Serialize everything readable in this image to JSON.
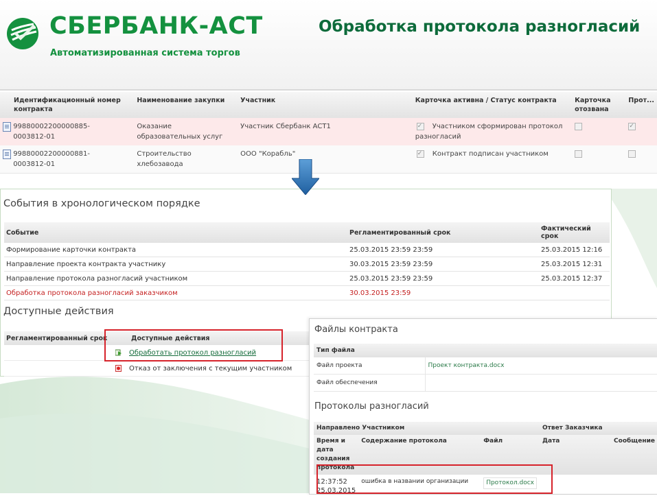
{
  "header": {
    "brand": "СБЕРБАНК-АСТ",
    "brand_subtitle": "Автоматизированная система торгов",
    "slide_title": "Обработка протокола разногласий",
    "brand_color": "#14913f"
  },
  "contracts": {
    "columns": [
      "Идентификационный номер контракта",
      "Наименование закупки",
      "Участник",
      "Карточка активна / Статус контракта",
      "Карточка отозвана",
      "Прот..."
    ],
    "rows": [
      {
        "id": "99880002200000885-0003812-01",
        "name": "Оказание образовательных услуг",
        "participant": "Участник Сбербанк АСТ1",
        "status": "Участником сформирован протокол разногласий",
        "active": true,
        "revoked": false,
        "protocol": true
      },
      {
        "id": "99880002200000881-0003812-01",
        "name": "Строительство хлебозавода",
        "participant": "ООО \"Корабль\"",
        "status": "Контракт подписан участником",
        "active": true,
        "revoked": false,
        "protocol": false
      }
    ]
  },
  "events": {
    "title": "События в хронологическом порядке",
    "columns": [
      "Событие",
      "Регламентированный срок",
      "Фактический срок"
    ],
    "rows": [
      {
        "event": "Формирование карточки контракта",
        "deadline": "25.03.2015 23:59 23:59",
        "actual": "25.03.2015 12:16",
        "alert": false
      },
      {
        "event": "Направление проекта контракта участнику",
        "deadline": "30.03.2015 23:59 23:59",
        "actual": "25.03.2015 12:31",
        "alert": false
      },
      {
        "event": "Направление протокола разногласий участником",
        "deadline": "25.03.2015 23:59 23:59",
        "actual": "25.03.2015 12:37",
        "alert": false
      },
      {
        "event": "Обработка протокола разногласий заказчиком",
        "deadline": "30.03.2015 23:59",
        "actual": "",
        "alert": true
      }
    ]
  },
  "actions": {
    "title": "Доступные действия",
    "columns": [
      "Регламентированный срок",
      "Доступные действия"
    ],
    "items": [
      {
        "label": "Обработать протокол разногласий",
        "icon": "process-protocol-icon",
        "link": true
      },
      {
        "label": "Отказ от заключения с текущим участником",
        "icon": "refuse-icon",
        "link": false
      }
    ]
  },
  "files": {
    "title": "Файлы контракта",
    "type_header": "Тип файла",
    "rows": [
      {
        "type": "Файл проекта",
        "value": "Проект контракта.docx"
      },
      {
        "type": "Файл обеспечения",
        "value": ""
      }
    ]
  },
  "protocols": {
    "title": "Протоколы разногласий",
    "group_sent": "Направлено Участником",
    "group_answer": "Ответ Заказчика",
    "columns": [
      "Время и дата создания протокола",
      "Содержание протокола",
      "Файл",
      "Дата",
      "Сообщение"
    ],
    "rows": [
      {
        "time": "12:37:52 25.03.2015",
        "content": "ошибка в названии организации",
        "file": "Протокол.docx",
        "date": "",
        "message": ""
      }
    ]
  },
  "colors": {
    "accent_green": "#14913f",
    "alert_red": "#c41e1e",
    "frame_red": "#d6222a",
    "arrow_blue": "#2e6fb0"
  }
}
